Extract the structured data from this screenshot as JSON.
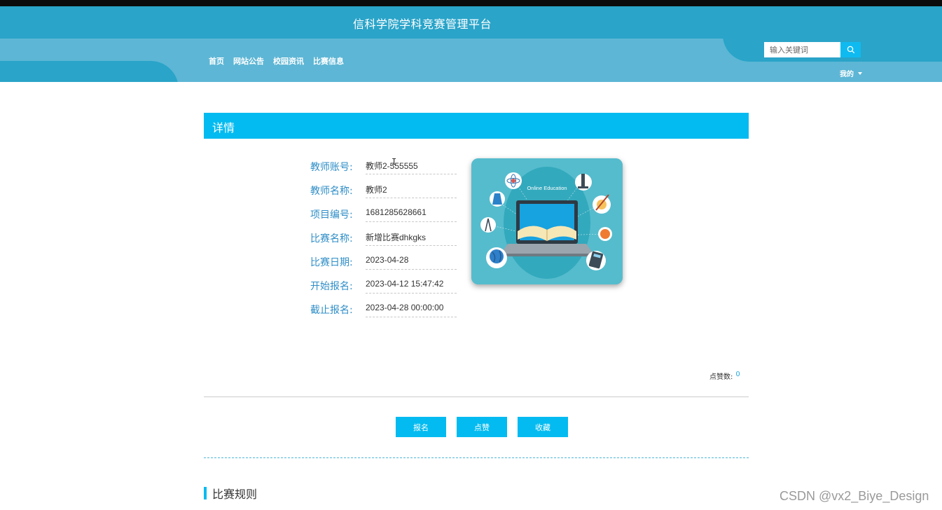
{
  "header": {
    "site_title": "信科学院学科竞赛管理平台",
    "nav": [
      "首页",
      "网站公告",
      "校园资讯",
      "比赛信息"
    ],
    "search_placeholder": "输入关键词",
    "mine_label": "我的"
  },
  "detail": {
    "section_title": "详情",
    "fields": [
      {
        "label": "教师账号:",
        "value": "教师2-555555"
      },
      {
        "label": "教师名称:",
        "value": "教师2"
      },
      {
        "label": "项目编号:",
        "value": "1681285628661"
      },
      {
        "label": "比赛名称:",
        "value": "新增比赛dhkgks"
      },
      {
        "label": "比赛日期:",
        "value": "2023-04-28"
      },
      {
        "label": "开始报名:",
        "value": "2023-04-12 15:47:42"
      },
      {
        "label": "截止报名:",
        "value": "2023-04-28 00:00:00"
      }
    ],
    "cover_caption": "Online Education",
    "likes_label": "点赞数:",
    "likes_count": "0"
  },
  "actions": {
    "register": "报名",
    "like": "点赞",
    "favorite": "收藏"
  },
  "rules": {
    "title": "比赛规则"
  },
  "watermark": "CSDN @vx2_Biye_Design",
  "colors": {
    "header": "#2aa4c9",
    "accent": "#03bbf0",
    "label": "#2f8ec7"
  }
}
